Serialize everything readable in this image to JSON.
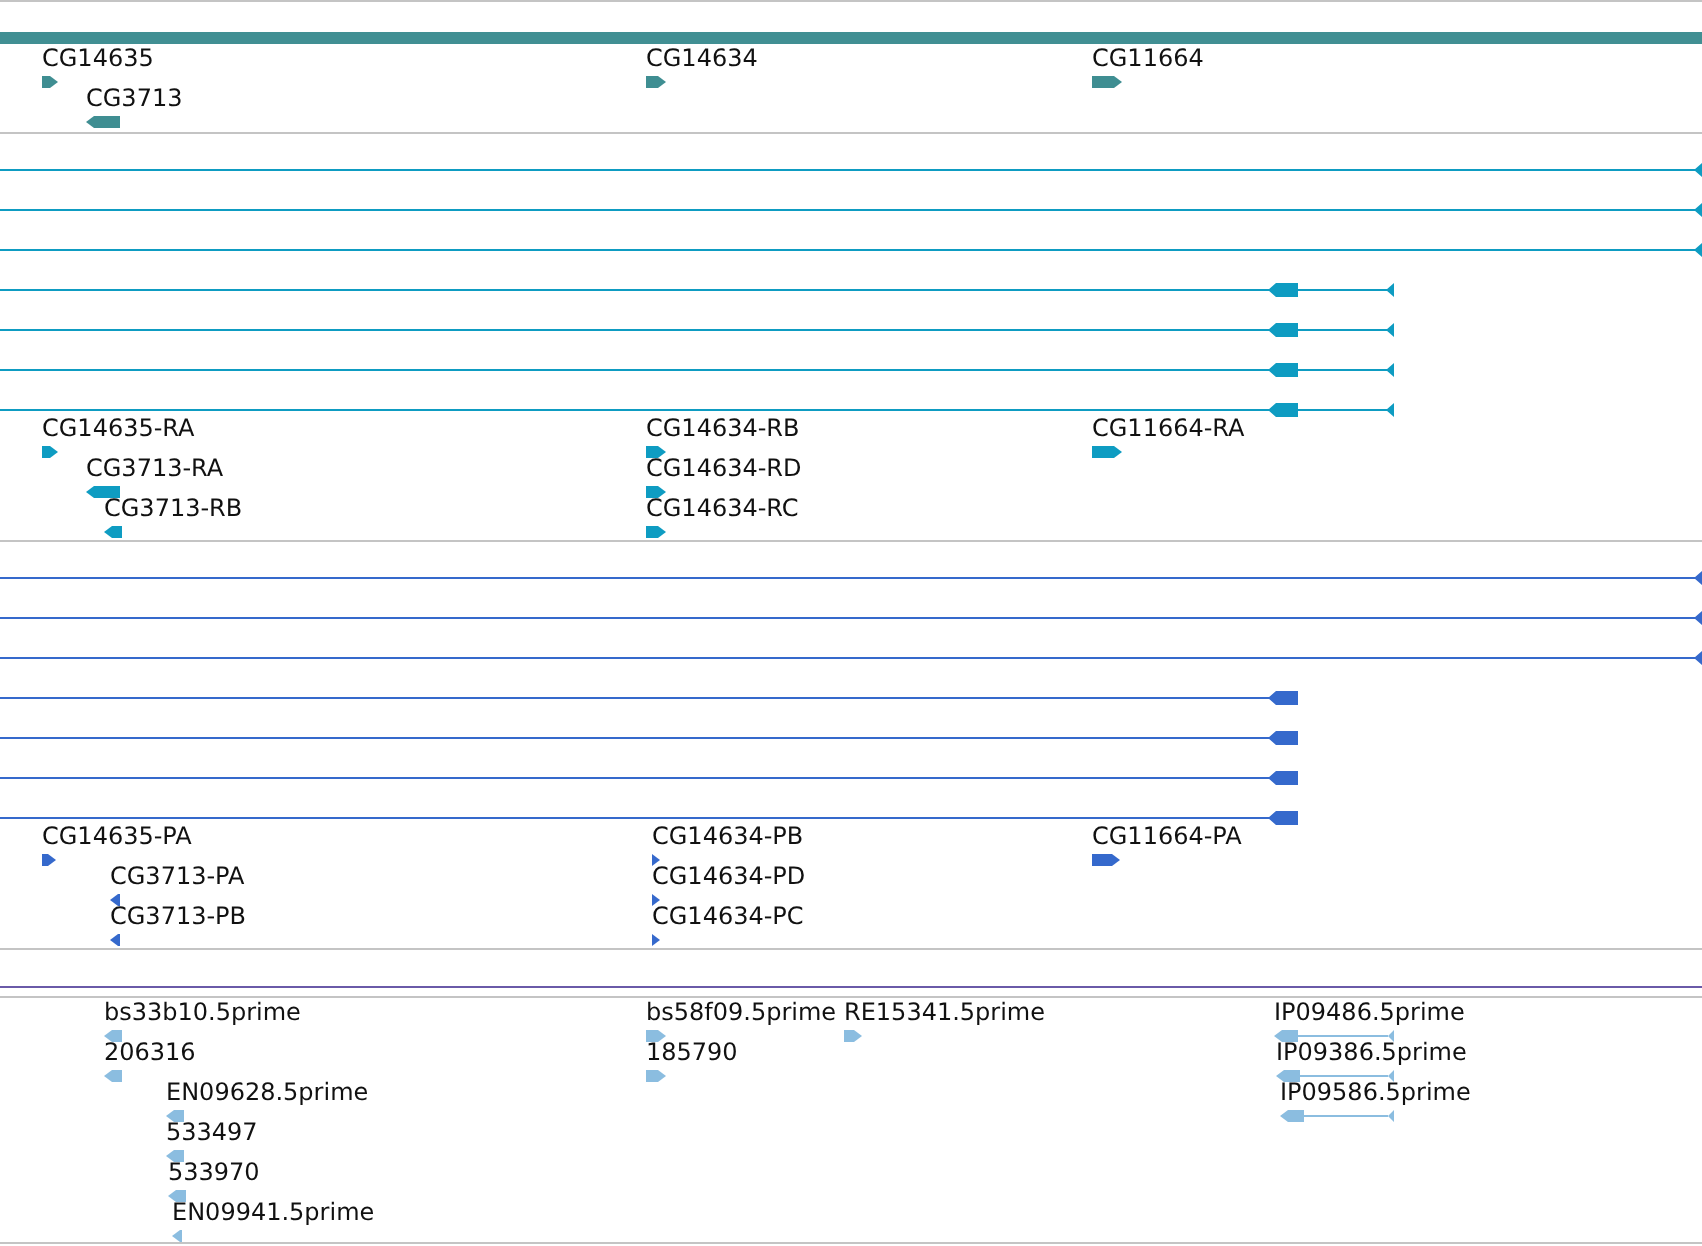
{
  "tracks": [
    {
      "kind": "genes",
      "color": "#3f8e92",
      "features": [
        {
          "label": "CG14635",
          "reverse": false
        },
        {
          "label": "CG3713",
          "reverse": true
        },
        {
          "label": "CG14634",
          "reverse": false
        },
        {
          "label": "CG11664",
          "reverse": false
        }
      ]
    },
    {
      "kind": "transcripts",
      "color": "#0e9cc2",
      "features": [
        {
          "label": "CG14635-RA",
          "reverse": false
        },
        {
          "label": "CG3713-RA",
          "reverse": true
        },
        {
          "label": "CG3713-RB",
          "reverse": true
        },
        {
          "label": "CG14634-RB",
          "reverse": false
        },
        {
          "label": "CG14634-RD",
          "reverse": false
        },
        {
          "label": "CG14634-RC",
          "reverse": false
        },
        {
          "label": "CG11664-RA",
          "reverse": false
        }
      ]
    },
    {
      "kind": "proteins",
      "color": "#3569cc",
      "features": [
        {
          "label": "CG14635-PA",
          "reverse": false
        },
        {
          "label": "CG3713-PA",
          "reverse": true
        },
        {
          "label": "CG3713-PB",
          "reverse": true
        },
        {
          "label": "CG14634-PB",
          "reverse": false
        },
        {
          "label": "CG14634-PD",
          "reverse": false
        },
        {
          "label": "CG14634-PC",
          "reverse": false
        },
        {
          "label": "CG11664-PA",
          "reverse": false
        }
      ]
    },
    {
      "kind": "ests",
      "color": "#8bbde0",
      "features": [
        {
          "label": "bs33b10.5prime",
          "reverse": true
        },
        {
          "label": "206316",
          "reverse": true
        },
        {
          "label": "EN09628.5prime",
          "reverse": true
        },
        {
          "label": "533497",
          "reverse": true
        },
        {
          "label": "533970",
          "reverse": true
        },
        {
          "label": "EN09941.5prime",
          "reverse": true
        },
        {
          "label": "bs58f09.5prime",
          "reverse": false
        },
        {
          "label": "185790",
          "reverse": false
        },
        {
          "label": "RE15341.5prime",
          "reverse": false
        },
        {
          "label": "IP09486.5prime",
          "reverse": true
        },
        {
          "label": "IP09386.5prime",
          "reverse": true
        },
        {
          "label": "IP09586.5prime",
          "reverse": true
        }
      ]
    }
  ]
}
